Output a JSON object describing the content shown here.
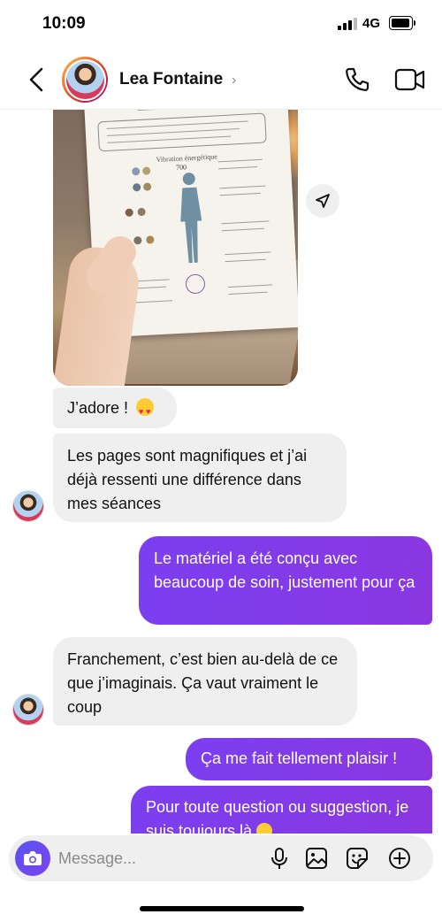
{
  "status_bar": {
    "time": "10:09",
    "network": "4G"
  },
  "header": {
    "contact_name": "Lea Fontaine",
    "chevron": "›",
    "icons": [
      "back-arrow-icon",
      "phone-icon",
      "video-camera-icon"
    ]
  },
  "chat": {
    "photo": {
      "document_title": "Vibration énergétique",
      "document_value": "700"
    },
    "messages": [
      {
        "direction": "in",
        "text": "J’adore ! ",
        "emoji": "smiling-face-with-heart-eyes"
      },
      {
        "direction": "in",
        "text": "Les pages sont magnifiques et j’ai déjà ressenti une différence dans mes séances"
      },
      {
        "direction": "out",
        "text": "Le matériel a été conçu avec beaucoup de soin, justement pour ça"
      },
      {
        "direction": "in",
        "text": "Franchement, c’est bien au-delà de ce que j’imaginais. Ça vaut vraiment le coup"
      },
      {
        "direction": "out",
        "text": "Ça me fait tellement plaisir !"
      },
      {
        "direction": "out",
        "text": "Pour toute question ou suggestion, je suis toujours là ",
        "emoji": "smiling-face"
      }
    ]
  },
  "composer": {
    "placeholder": "Message...",
    "value": "",
    "icons": [
      "camera-icon",
      "microphone-icon",
      "image-icon",
      "sticker-icon",
      "plus-circle-icon"
    ]
  },
  "colors": {
    "outgoing_bubble": "#7b3ff0",
    "incoming_bubble": "#efefef",
    "camera_button": "#5a53f0"
  }
}
